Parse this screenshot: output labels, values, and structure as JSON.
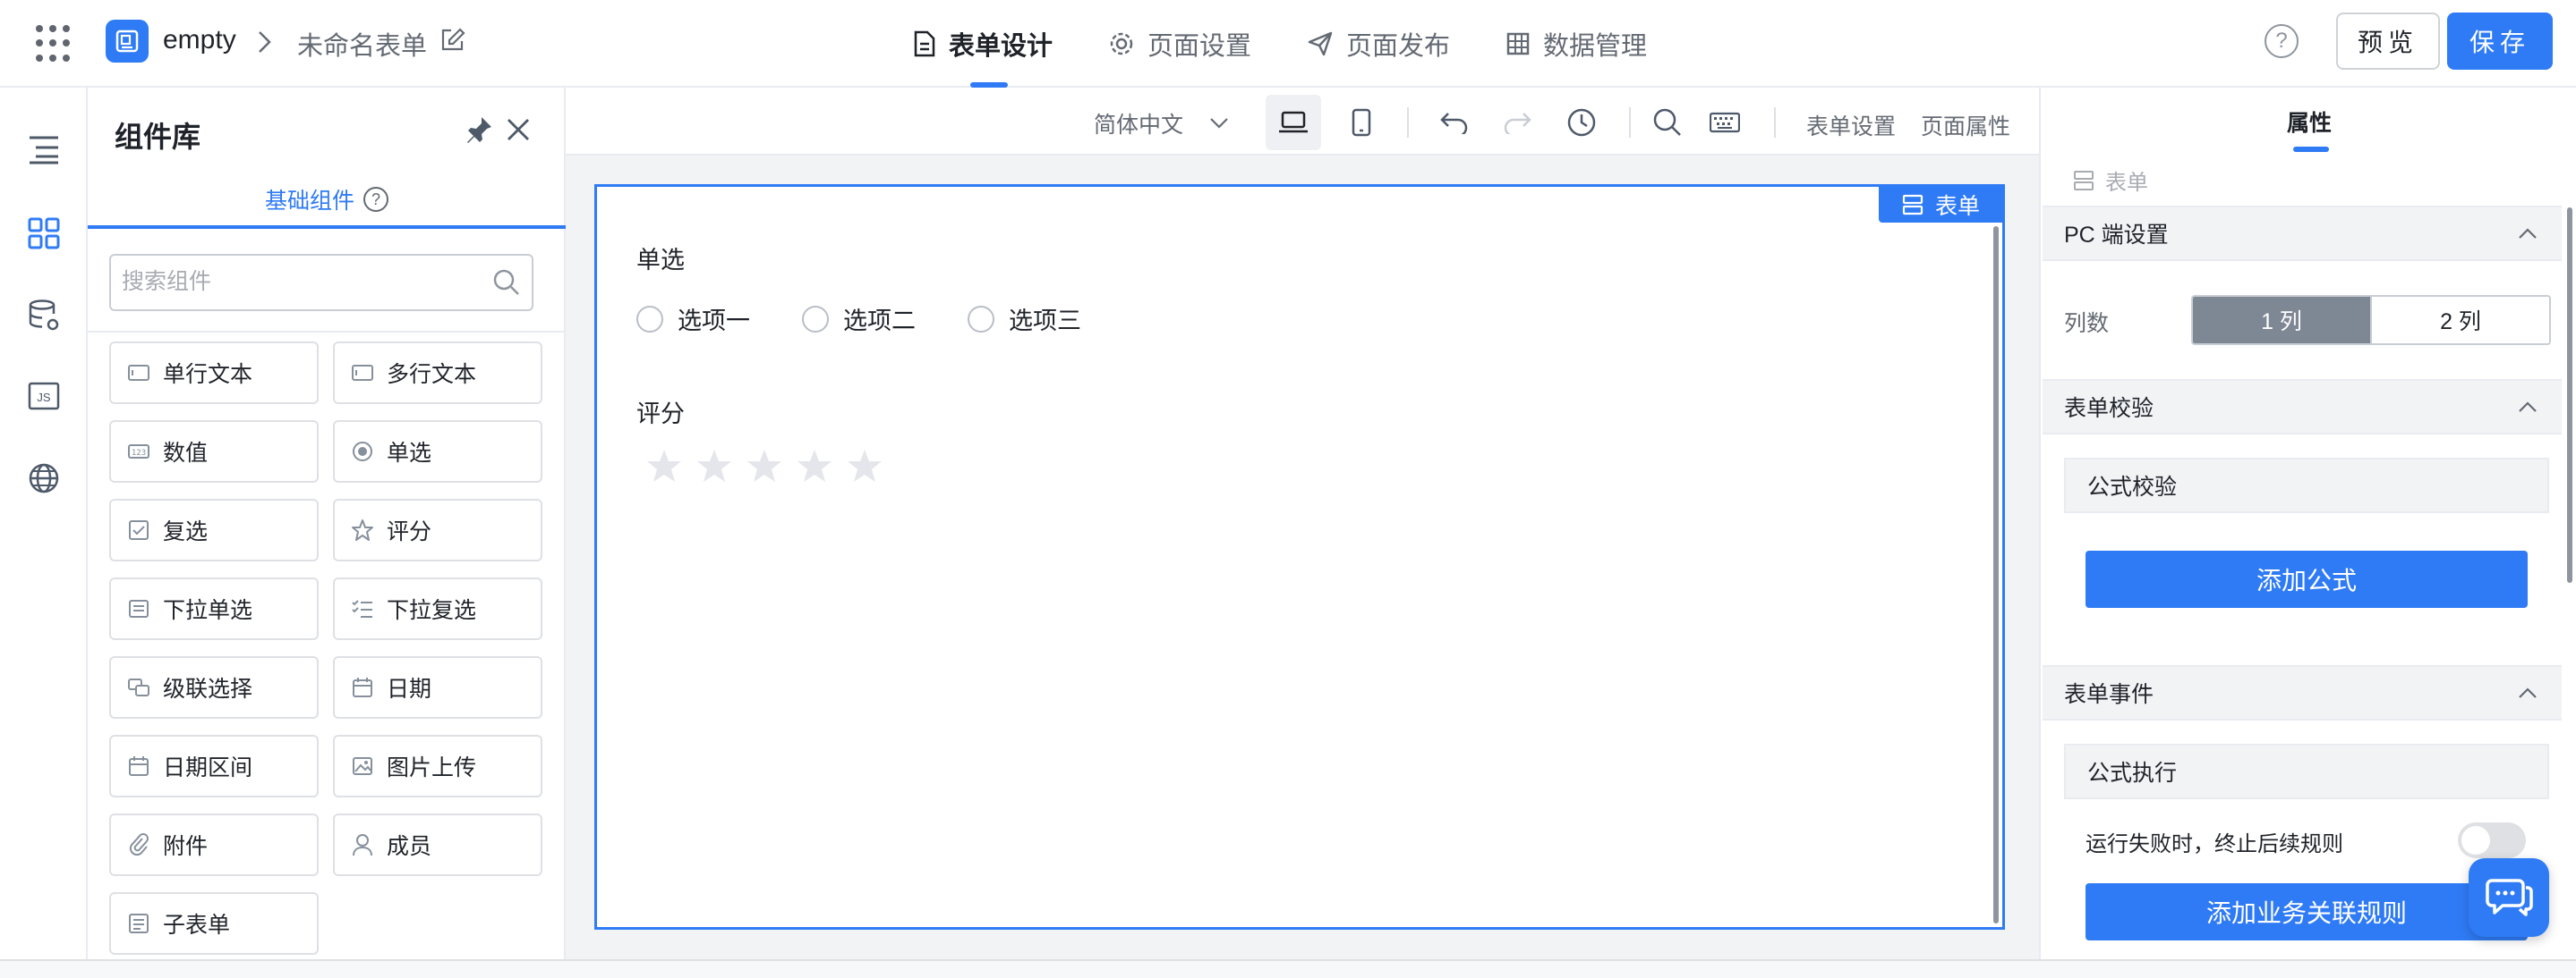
{
  "header": {
    "app_name": "empty",
    "form_title": "未命名表单",
    "nav": [
      {
        "label": "表单设计",
        "icon": "document-icon",
        "active": true
      },
      {
        "label": "页面设置",
        "icon": "gear-icon",
        "active": false
      },
      {
        "label": "页面发布",
        "icon": "send-icon",
        "active": false
      },
      {
        "label": "数据管理",
        "icon": "grid-icon",
        "active": false
      }
    ],
    "help_label": "?",
    "preview_label": "预览",
    "save_label": "保存"
  },
  "rail": {
    "items": [
      "outline-icon",
      "components-icon",
      "datasource-icon",
      "js-icon",
      "globe-icon"
    ],
    "js_label": "JS"
  },
  "library": {
    "title": "组件库",
    "tab_label": "基础组件",
    "tab_help": "?",
    "search_placeholder": "搜索组件",
    "components": [
      {
        "label": "单行文本",
        "icon": "single-line-text-icon"
      },
      {
        "label": "多行文本",
        "icon": "multi-line-text-icon"
      },
      {
        "label": "数值",
        "icon": "number-icon"
      },
      {
        "label": "单选",
        "icon": "radio-icon"
      },
      {
        "label": "复选",
        "icon": "checkbox-icon"
      },
      {
        "label": "评分",
        "icon": "star-icon"
      },
      {
        "label": "下拉单选",
        "icon": "dropdown-single-icon"
      },
      {
        "label": "下拉复选",
        "icon": "dropdown-multi-icon"
      },
      {
        "label": "级联选择",
        "icon": "cascade-icon"
      },
      {
        "label": "日期",
        "icon": "calendar-icon"
      },
      {
        "label": "日期区间",
        "icon": "date-range-icon"
      },
      {
        "label": "图片上传",
        "icon": "image-upload-icon"
      },
      {
        "label": "附件",
        "icon": "paperclip-icon"
      },
      {
        "label": "成员",
        "icon": "member-icon"
      },
      {
        "label": "子表单",
        "icon": "subform-icon"
      }
    ]
  },
  "toolbar": {
    "language": "简体中文",
    "form_settings": "表单设置",
    "page_properties": "页面属性"
  },
  "canvas": {
    "tag": "表单",
    "radio_field": {
      "label": "单选",
      "options": [
        "选项一",
        "选项二",
        "选项三"
      ]
    },
    "rating_field": {
      "label": "评分",
      "stars": 5,
      "value": 0
    }
  },
  "properties": {
    "tab_label": "属性",
    "crumb": "表单",
    "pc_section": "PC 端设置",
    "columns_label": "列数",
    "column_options": [
      "1 列",
      "2 列"
    ],
    "selected_column": 0,
    "validation_section": "表单校验",
    "formula_validation": "公式校验",
    "add_formula": "添加公式",
    "events_section": "表单事件",
    "formula_execution": "公式执行",
    "stop_on_failure": "运行失败时，终止后续规则",
    "stop_on_failure_enabled": false,
    "add_business_rule": "添加业务关联规则"
  },
  "colors": {
    "accent": "#2f7bf5",
    "segment_selected": "#7e8794",
    "panel_bg": "#f2f3f5"
  }
}
